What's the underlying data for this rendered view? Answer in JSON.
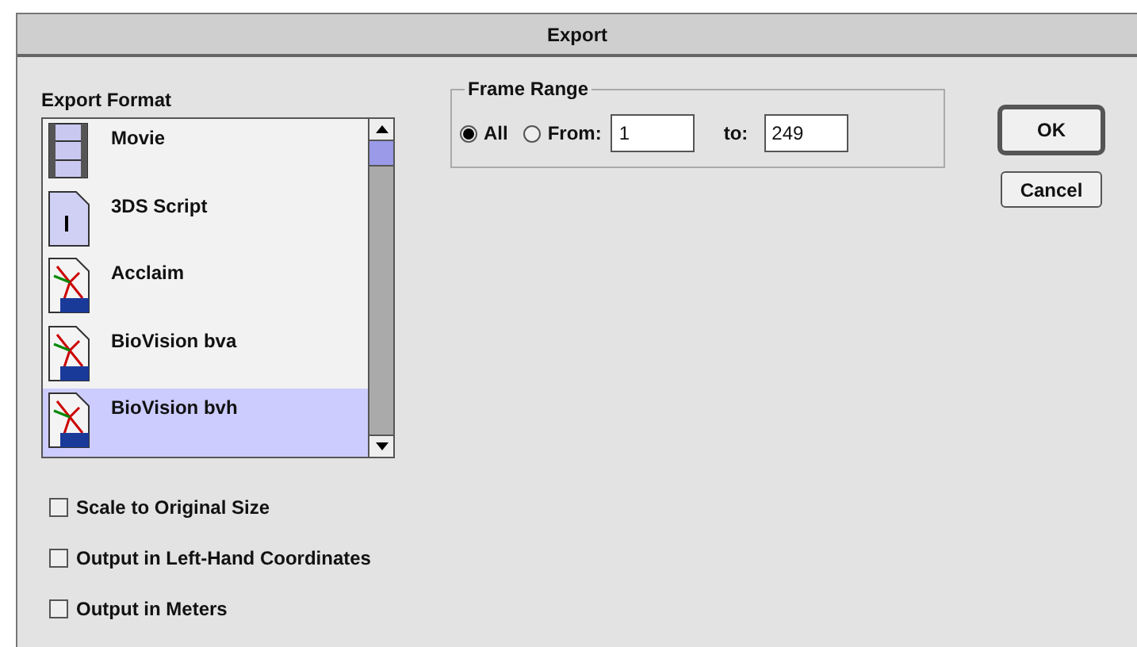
{
  "window": {
    "title": "Export"
  },
  "export_format": {
    "label": "Export Format",
    "items": [
      {
        "name": "Movie",
        "kind": "movie",
        "selected": false
      },
      {
        "name": "3DS Script",
        "kind": "script",
        "selected": false
      },
      {
        "name": "Acclaim",
        "kind": "motion",
        "selected": false
      },
      {
        "name": "BioVision bva",
        "kind": "motion",
        "selected": false
      },
      {
        "name": "BioVision bvh",
        "kind": "motion",
        "selected": true
      }
    ]
  },
  "frame_range": {
    "label": "Frame Range",
    "options": [
      {
        "label": "All",
        "selected": true
      },
      {
        "label": "From:",
        "selected": false
      }
    ],
    "from": "1",
    "to_label": "to:",
    "to": "249"
  },
  "buttons": [
    {
      "label": "OK",
      "default": true
    },
    {
      "label": "Cancel",
      "default": false
    }
  ],
  "options": [
    {
      "label": "Scale to Original Size",
      "checked": false
    },
    {
      "label": "Output in Left-Hand Coordinates",
      "checked": false
    },
    {
      "label": "Output in Meters",
      "checked": false
    }
  ]
}
